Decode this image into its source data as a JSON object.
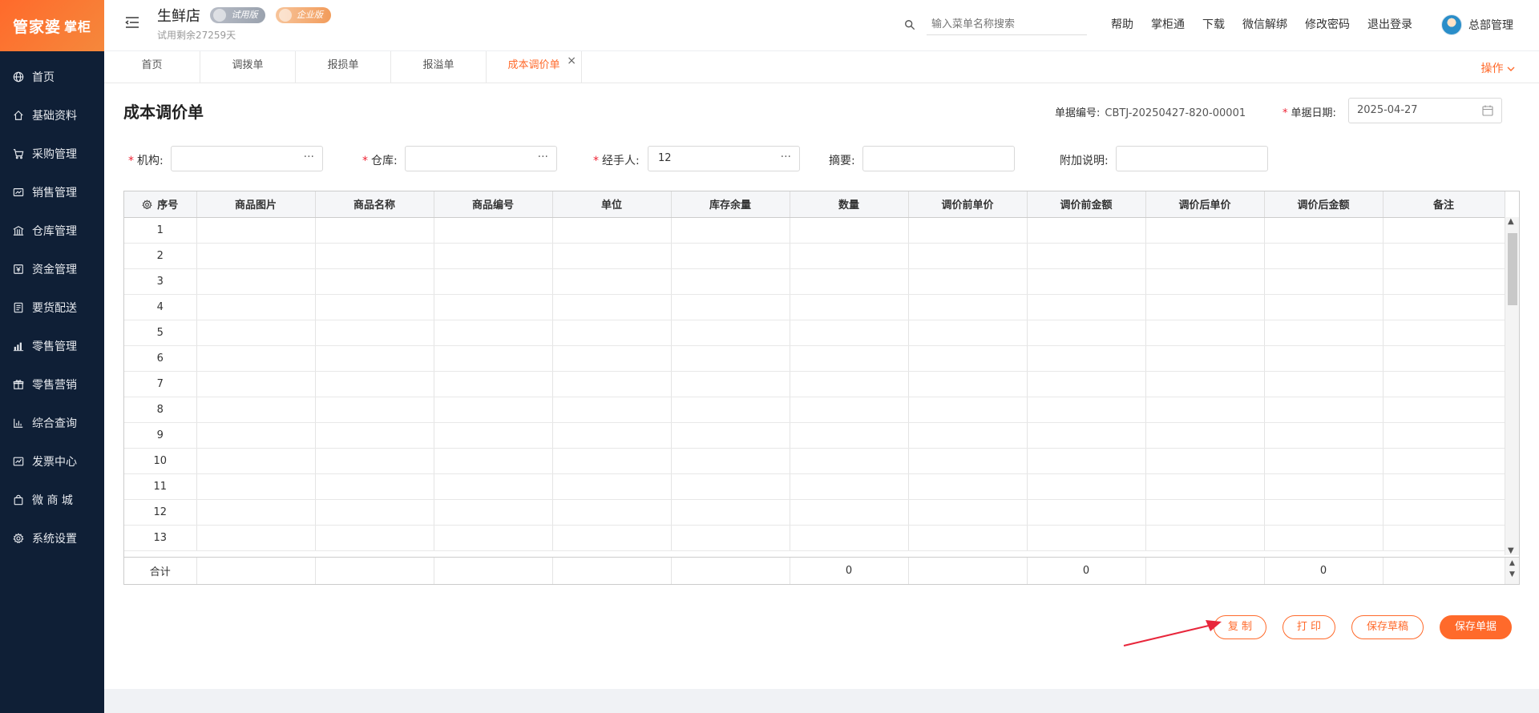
{
  "logo": {
    "main": "管家婆",
    "sub": "掌柜"
  },
  "sidebar": {
    "items": [
      {
        "label": "首页",
        "icon": "globe-icon"
      },
      {
        "label": "基础资料",
        "icon": "home-icon"
      },
      {
        "label": "采购管理",
        "icon": "cart-icon"
      },
      {
        "label": "销售管理",
        "icon": "sales-icon"
      },
      {
        "label": "仓库管理",
        "icon": "warehouse-icon"
      },
      {
        "label": "资金管理",
        "icon": "money-icon"
      },
      {
        "label": "要货配送",
        "icon": "list-icon"
      },
      {
        "label": "零售管理",
        "icon": "chart-icon"
      },
      {
        "label": "零售营销",
        "icon": "gift-icon"
      },
      {
        "label": "综合查询",
        "icon": "bar-chart-icon"
      },
      {
        "label": "发票中心",
        "icon": "invoice-icon"
      },
      {
        "label": "微 商 城",
        "icon": "bag-icon"
      },
      {
        "label": "系统设置",
        "icon": "gear-icon"
      }
    ]
  },
  "header": {
    "store_name": "生鲜店",
    "badge_trial": "试用版",
    "badge_enterprise": "企业版",
    "trial_days": "试用剩余27259天",
    "search_placeholder": "输入菜单名称搜索",
    "links": [
      "帮助",
      "掌柜通",
      "下载",
      "微信解绑",
      "修改密码",
      "退出登录"
    ],
    "user_name": "总部管理"
  },
  "tabs": {
    "items": [
      "首页",
      "调拨单",
      "报损单",
      "报溢单",
      "成本调价单"
    ],
    "active": "成本调价单",
    "close_glyph": "×",
    "ops_label": "操作"
  },
  "form": {
    "title": "成本调价单",
    "doc_no_label": "单据编号:",
    "doc_no_value": "CBTJ-20250427-820-00001",
    "doc_date_label": "单据日期:",
    "doc_date_value": "2025-04-27",
    "required_mark": "*",
    "org_label": "机构:",
    "org_value": "",
    "warehouse_label": "仓库:",
    "warehouse_value": "",
    "handler_label": "经手人:",
    "handler_value": "12",
    "summary_label": "摘要:",
    "summary_value": "",
    "note_label": "附加说明:",
    "note_value": "",
    "dots": "···"
  },
  "table": {
    "columns": [
      "序号",
      "商品图片",
      "商品名称",
      "商品编号",
      "单位",
      "库存余量",
      "数量",
      "调价前单价",
      "调价前金额",
      "调价后单价",
      "调价后金额",
      "备注"
    ],
    "rows": [
      "1",
      "2",
      "3",
      "4",
      "5",
      "6",
      "7",
      "8",
      "9",
      "10",
      "11",
      "12",
      "13"
    ],
    "total_label": "合计",
    "totals": {
      "quantity": "0",
      "amount_before": "0",
      "amount_after": "0"
    }
  },
  "buttons": {
    "copy": "复 制",
    "print": "打 印",
    "save_draft": "保存草稿",
    "save": "保存单据"
  },
  "colors": {
    "accent": "#ff6a2b",
    "sidebar": "#0f1f36",
    "annotation_arrow": "#e8263b"
  }
}
